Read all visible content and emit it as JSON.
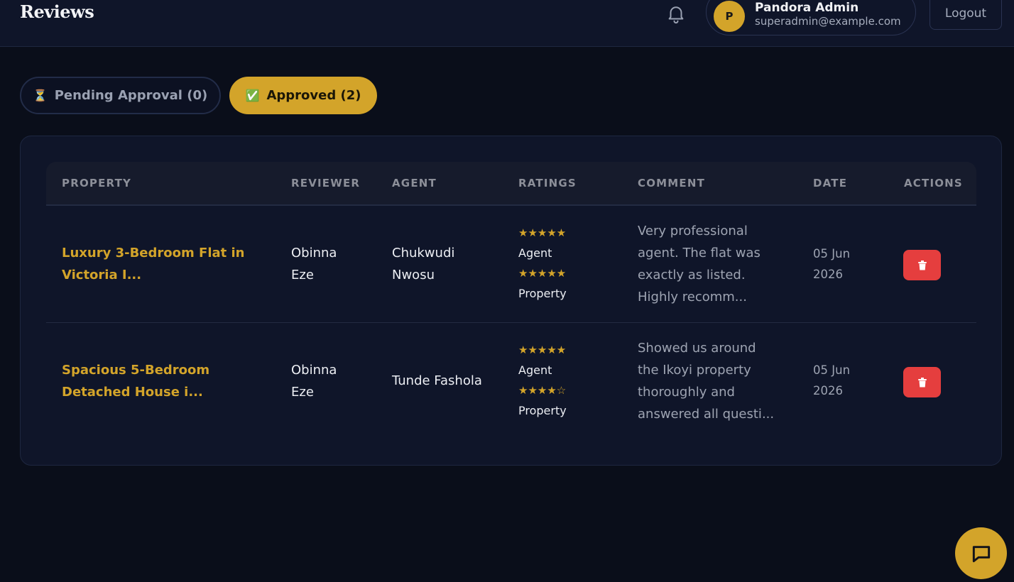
{
  "header": {
    "title": "Reviews",
    "user": {
      "initial": "P",
      "name": "Pandora Admin",
      "email": "superadmin@example.com"
    },
    "logout_label": "Logout"
  },
  "tabs": [
    {
      "emoji": "⏳",
      "label": "Pending Approval (0)",
      "active": false
    },
    {
      "emoji": "✅",
      "label": "Approved (2)",
      "active": true
    }
  ],
  "table": {
    "columns": [
      "PROPERTY",
      "REVIEWER",
      "AGENT",
      "RATINGS",
      "COMMENT",
      "DATE",
      "ACTIONS"
    ],
    "rows": [
      {
        "property_lines": [
          "Luxury 3-Bedroom Flat in",
          "Victoria I..."
        ],
        "reviewer_lines": [
          "Obinna",
          "Eze"
        ],
        "agent_lines": [
          "Chukwudi",
          "Nwosu"
        ],
        "agent_stars": "★★★★★",
        "agent_label": "Agent",
        "property_stars": "★★★★★",
        "property_label": "Property",
        "agent_rating": 5,
        "property_rating": 5,
        "comment_lines": [
          "Very professional",
          "agent. The flat was",
          "exactly as listed.",
          "Highly recomm..."
        ],
        "date_lines": [
          "05 Jun",
          "2026"
        ]
      },
      {
        "property_lines": [
          "Spacious 5-Bedroom",
          "Detached House i..."
        ],
        "reviewer_lines": [
          "Obinna",
          "Eze"
        ],
        "agent_lines": [
          "Tunde Fashola"
        ],
        "agent_stars": "★★★★★",
        "agent_label": "Agent",
        "property_stars": "★★★★☆",
        "property_label": "Property",
        "agent_rating": 5,
        "property_rating": 4,
        "comment_lines": [
          "Showed us around",
          "the Ikoyi property",
          "thoroughly and",
          "answered all questi..."
        ],
        "date_lines": [
          "05 Jun",
          "2026"
        ]
      }
    ]
  },
  "colors": {
    "accent": "#d3a42a",
    "danger": "#e53e3e",
    "background": "#0a0e1a",
    "panel": "#0f1529"
  },
  "icons": {
    "notifications": "bell-icon",
    "delete": "trash-icon",
    "chat": "chat-icon"
  }
}
